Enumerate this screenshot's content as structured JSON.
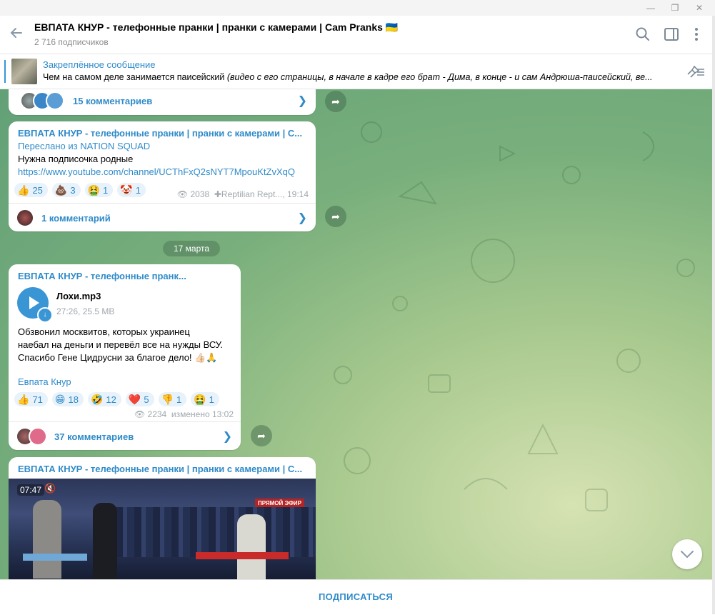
{
  "header": {
    "title": "ЕВПАТА КНУР - телефонные пранки | пранки с камерами | Cam Pranks 🇺🇦",
    "subscribers": "2 716 подписчиков"
  },
  "pinned": {
    "title": "Закреплённое сообщение",
    "text_plain": "Чем на самом деле занимается паисейский ",
    "text_italic": "(видео с его страницы, в начале в кадре его брат - Дима, в конце - и сам Андрюша-паисейский, ве..."
  },
  "messages": [
    {
      "comments": "15 комментариев"
    },
    {
      "channel": "ЕВПАТА КНУР - телефонные пранки | пранки с камерами | C...",
      "forwarded": "Переслано из NATION SQUAD",
      "text": "Нужна подписочка родные",
      "link": "https://www.youtube.com/channel/UCThFxQ2sNYT7MpouKtZvXqQ",
      "reactions": [
        {
          "emoji": "👍",
          "count": "25"
        },
        {
          "emoji": "💩",
          "count": "3"
        },
        {
          "emoji": "🤮",
          "count": "1"
        },
        {
          "emoji": "🤡",
          "count": "1"
        }
      ],
      "views": "2038",
      "author": "Reptilian Rept...,",
      "time": "19:14",
      "comments": "1 комментарий"
    },
    {
      "channel": "ЕВПАТА КНУР - телефонные пранк...",
      "file_name": "Лохи.mp3",
      "file_meta": "27:26, 25.5 MB",
      "text_lines": [
        "Обзвонил москвитов, которых украинец",
        "наебал на деньги и перевёл все на нужды ВСУ.",
        "Спасибо Гене Цидрусни за благое дело! 👍🏻🙏"
      ],
      "signature": "Евпата Кнур",
      "reactions": [
        {
          "emoji": "👍",
          "count": "71"
        },
        {
          "emoji": "😁",
          "count": "18"
        },
        {
          "emoji": "🤣",
          "count": "12"
        },
        {
          "emoji": "❤️",
          "count": "5"
        },
        {
          "emoji": "👎",
          "count": "1"
        },
        {
          "emoji": "🤮",
          "count": "1"
        }
      ],
      "views": "2234",
      "edited": "изменено 13:02",
      "comments": "37 комментариев"
    },
    {
      "channel": "ЕВПАТА КНУР - телефонные пранки | пранки с камерами | C...",
      "video_duration": "07:47",
      "video_badge": "ПРЯМОЙ ЭФИР"
    }
  ],
  "date_separator": "17 марта",
  "footer": {
    "subscribe": "ПОДПИСАТЬСЯ"
  },
  "colors": {
    "accent": "#2f8bc9",
    "play": "#3a95d5"
  }
}
